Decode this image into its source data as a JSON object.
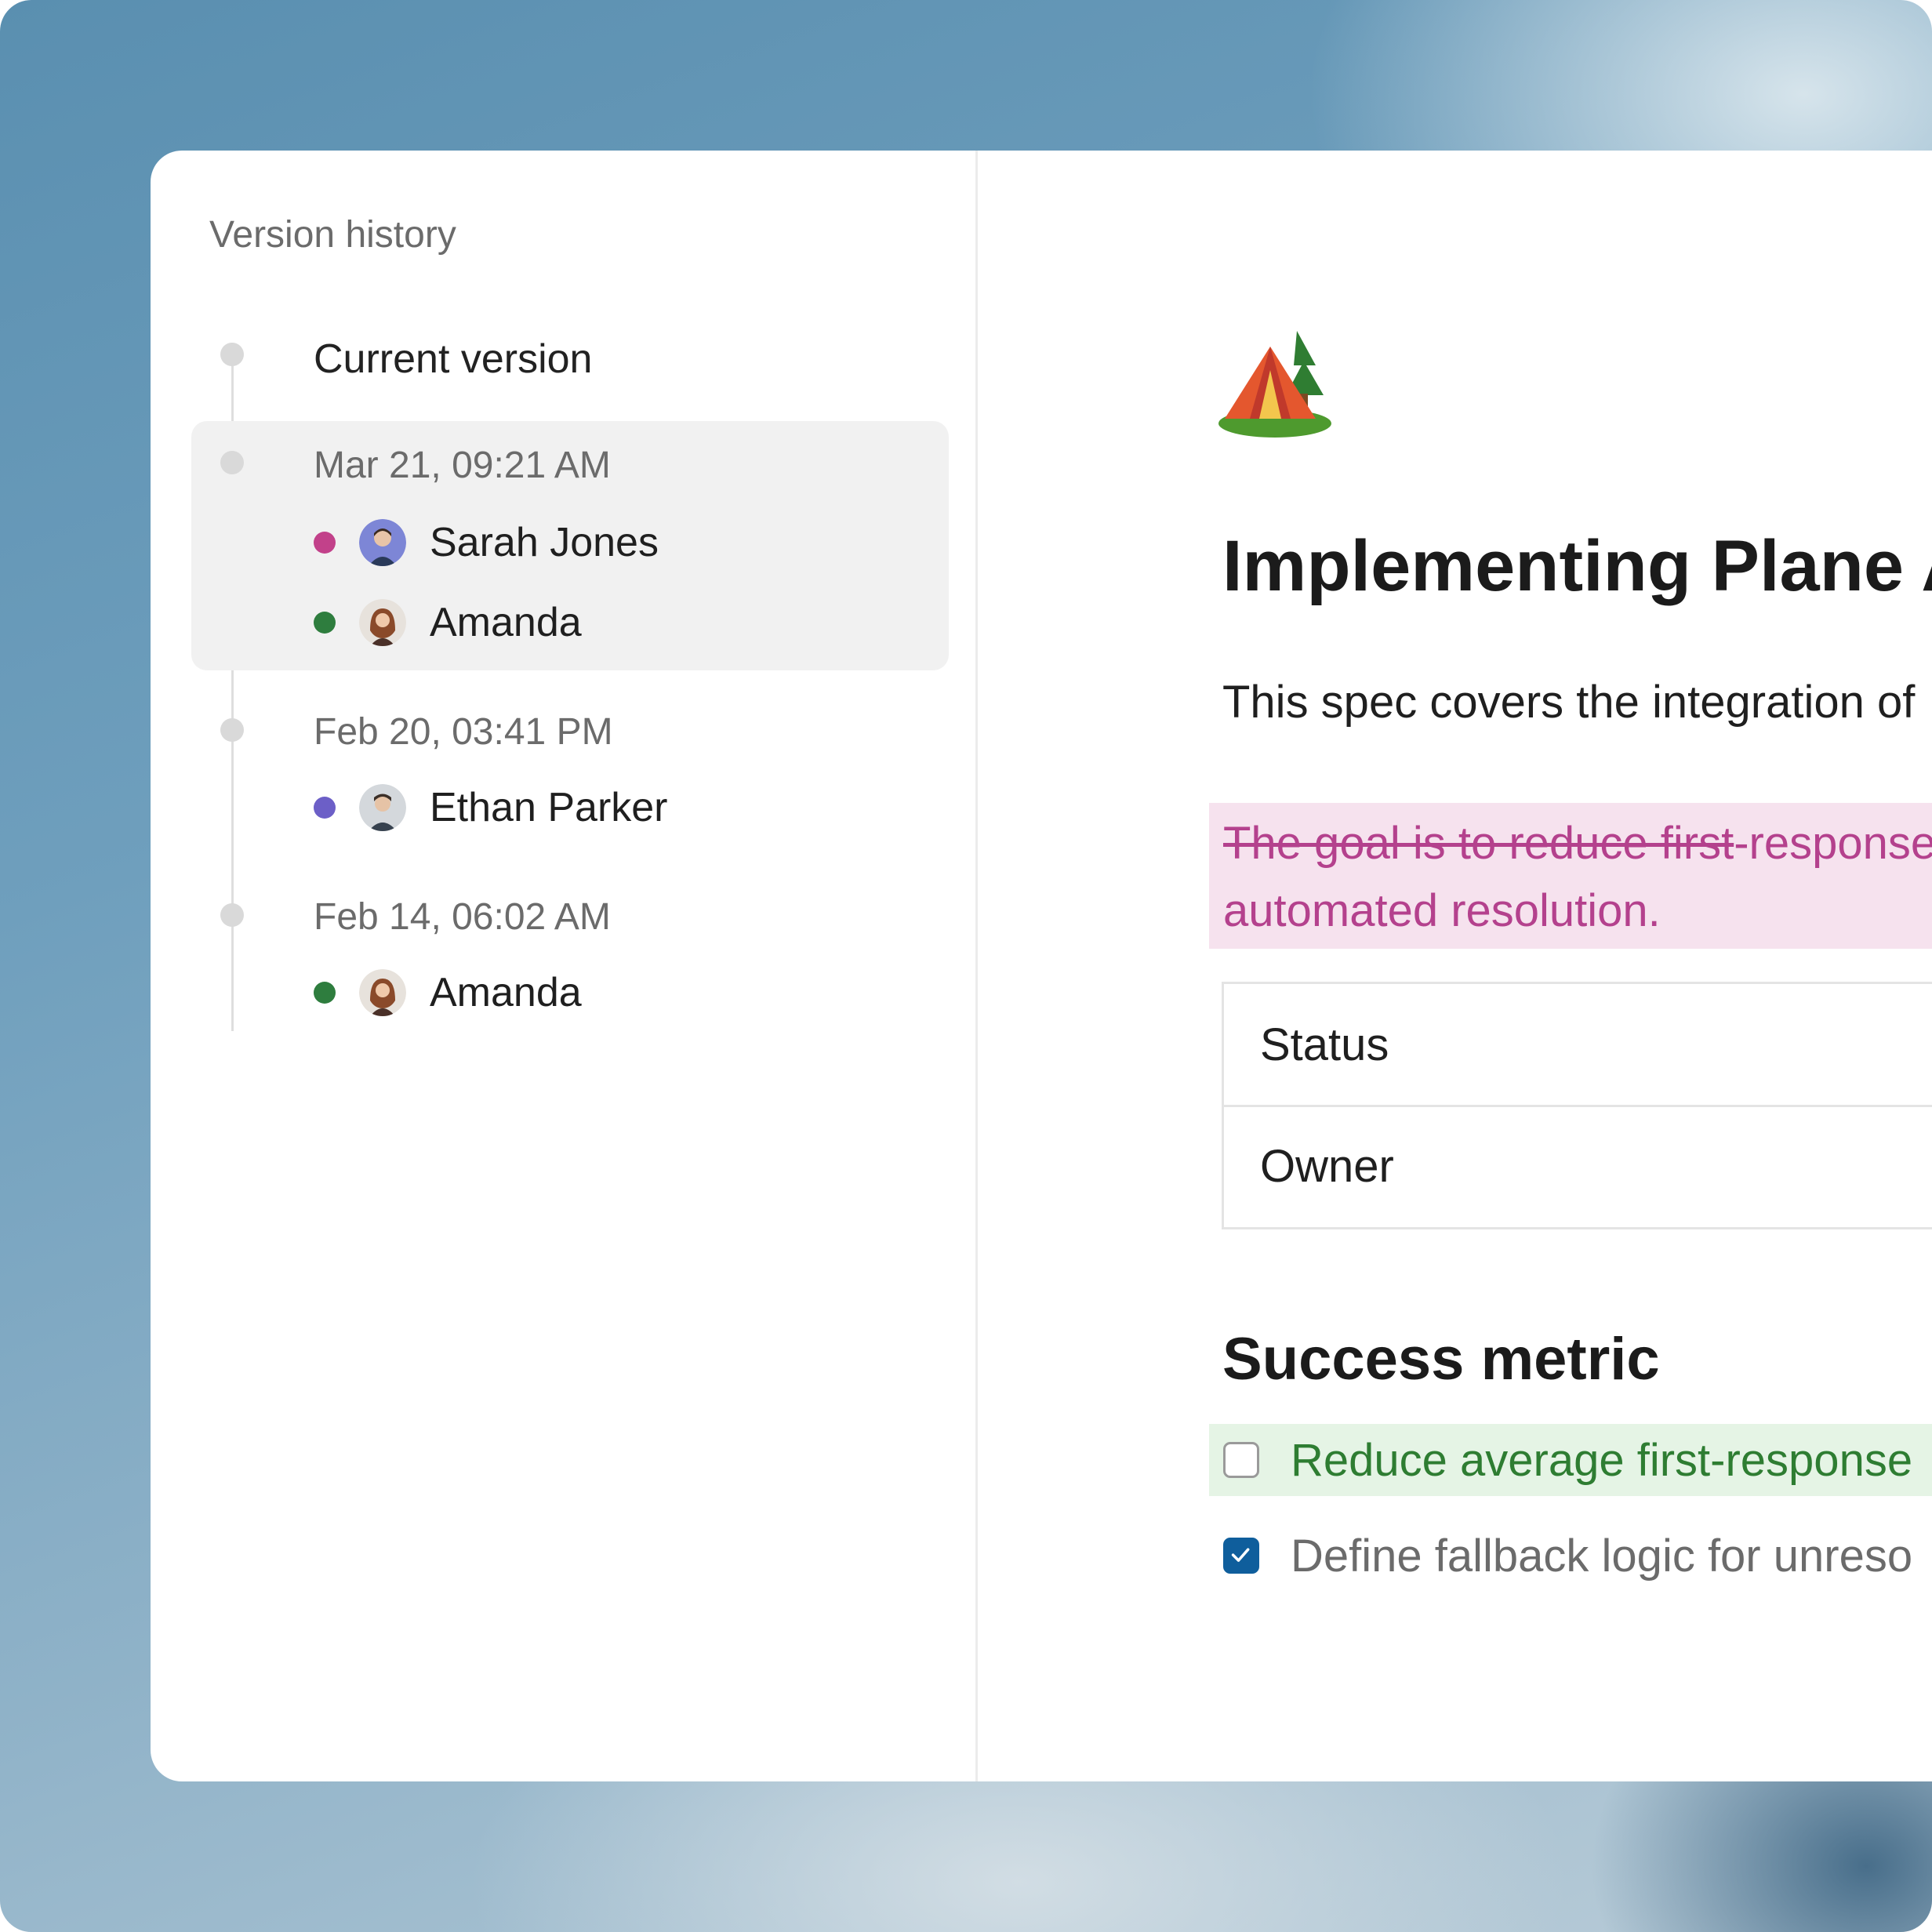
{
  "version_history": {
    "title": "Version history",
    "current_label": "Current version",
    "versions": [
      {
        "timestamp": "Mar 21, 09:21 AM",
        "authors": [
          {
            "name": "Sarah Jones",
            "color": "#c2418a"
          },
          {
            "name": "Amanda",
            "color": "#2e7d3e"
          }
        ]
      },
      {
        "timestamp": "Feb 20, 03:41 PM",
        "authors": [
          {
            "name": "Ethan Parker",
            "color": "#6c5fc7"
          }
        ]
      },
      {
        "timestamp": "Feb 14, 06:02 AM",
        "authors": [
          {
            "name": "Amanda",
            "color": "#2e7d3e"
          }
        ]
      }
    ]
  },
  "document": {
    "emoji": "camping-tent-emoji",
    "title": "Implementing Plane AI",
    "intro": "This spec covers the integration of",
    "diff": {
      "deleted": "The goal is to reduce first",
      "inserted_line1": "-response",
      "inserted_line2": "automated resolution."
    },
    "properties": [
      {
        "label": "Status"
      },
      {
        "label": "Owner"
      }
    ],
    "success_metric": {
      "heading": "Success metric",
      "tasks": [
        {
          "text": "Reduce average first-response",
          "checked": false
        },
        {
          "text": "Define fallback logic for unreso",
          "checked": true
        }
      ]
    }
  },
  "colors": {
    "diff_removed": "#b4418d",
    "diff_added_bg": "#e5f4e5",
    "checkbox_checked": "#0f5e9c"
  }
}
